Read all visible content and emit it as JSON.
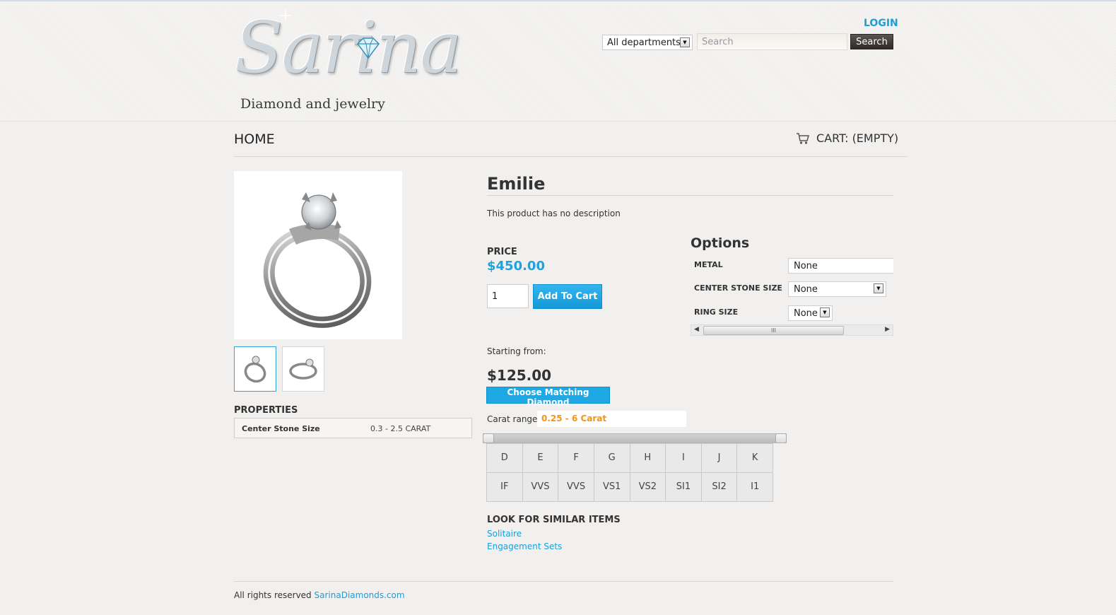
{
  "header": {
    "logo_text": "Sarina",
    "logo_tagline": "Diamond and jewelry",
    "login_label": "LOGIN",
    "department_selected": "All departments",
    "search_placeholder": "Search",
    "search_button": "Search"
  },
  "nav": {
    "home_label": "HOME",
    "cart_label": "CART: (EMPTY)"
  },
  "product": {
    "title": "Emilie",
    "description": "This product has no description",
    "price_label": "PRICE",
    "price": "$450.00",
    "quantity": "1",
    "add_to_cart": "Add To Cart"
  },
  "options": {
    "title": "Options",
    "items": [
      {
        "label": "METAL",
        "value": "None"
      },
      {
        "label": "CENTER STONE SIZE",
        "value": "None"
      },
      {
        "label": "RING SIZE",
        "value": "None"
      }
    ],
    "scroll_grip": "III"
  },
  "diamond": {
    "starting_label": "Starting from:",
    "starting_price": "$125.00",
    "choose_button": "Choose Matching Diamond",
    "carat_label": "Carat range:",
    "carat_range": "0.25 - 6  Carat",
    "colors": [
      "D",
      "E",
      "F",
      "G",
      "H",
      "I",
      "J",
      "K"
    ],
    "clarities": [
      "IF",
      "VVS",
      "VVS",
      "VS1",
      "VS2",
      "SI1",
      "SI2",
      "I1"
    ]
  },
  "properties": {
    "title": "PROPERTIES",
    "rows": [
      {
        "name": "Center Stone Size",
        "value": "0.3 - 2.5 CARAT"
      }
    ]
  },
  "similar": {
    "title": "LOOK FOR SIMILAR ITEMS",
    "links": [
      "Solitaire",
      "Engagement Sets"
    ]
  },
  "footer": {
    "text": "All rights reserved",
    "link": "SarinaDiamonds.com"
  },
  "colors": {
    "accent": "#1ea3dc",
    "carat_orange": "#f39416",
    "search_button": "#3d3835"
  }
}
